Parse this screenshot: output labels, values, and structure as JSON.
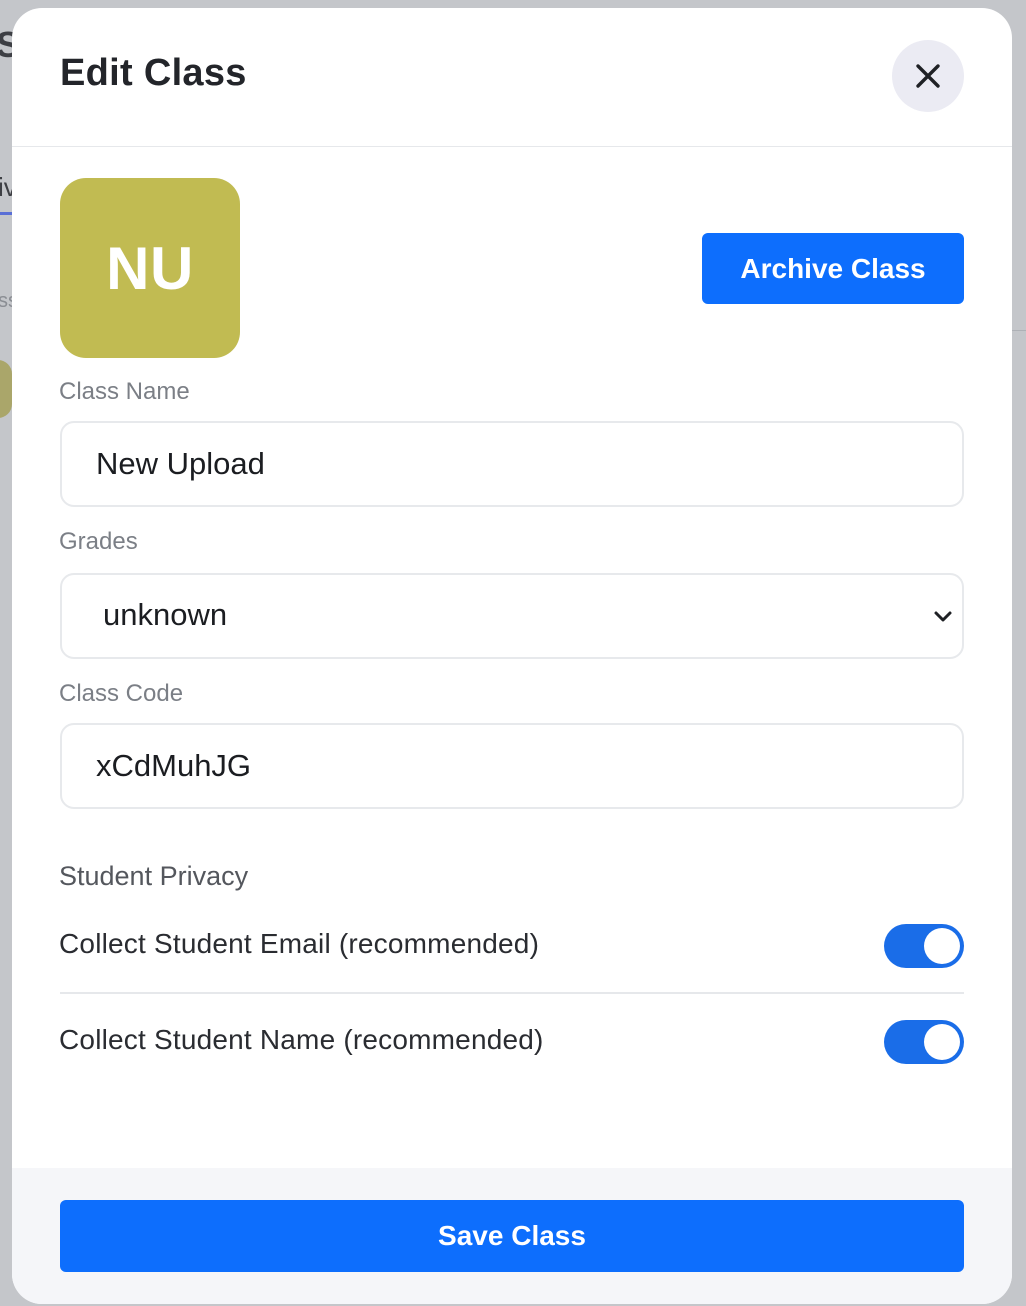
{
  "background": {
    "fragments": [
      "S",
      "iv",
      "ss"
    ]
  },
  "modal": {
    "title": "Edit Class"
  },
  "avatar": {
    "initials": "NU",
    "color": "#c1bb52"
  },
  "archive_button": {
    "label": "Archive Class"
  },
  "fields": {
    "class_name": {
      "label": "Class Name",
      "value": "New Upload"
    },
    "grades": {
      "label": "Grades",
      "selected": "unknown"
    },
    "class_code": {
      "label": "Class Code",
      "value": "xCdMuhJG"
    }
  },
  "privacy": {
    "section_label": "Student Privacy",
    "toggles": [
      {
        "label": "Collect Student Email (recommended)",
        "on": true
      },
      {
        "label": "Collect Student Name (recommended)",
        "on": true
      }
    ]
  },
  "save_button": {
    "label": "Save Class"
  },
  "colors": {
    "primary": "#0d6efd",
    "toggle_on": "#1a6de8"
  }
}
